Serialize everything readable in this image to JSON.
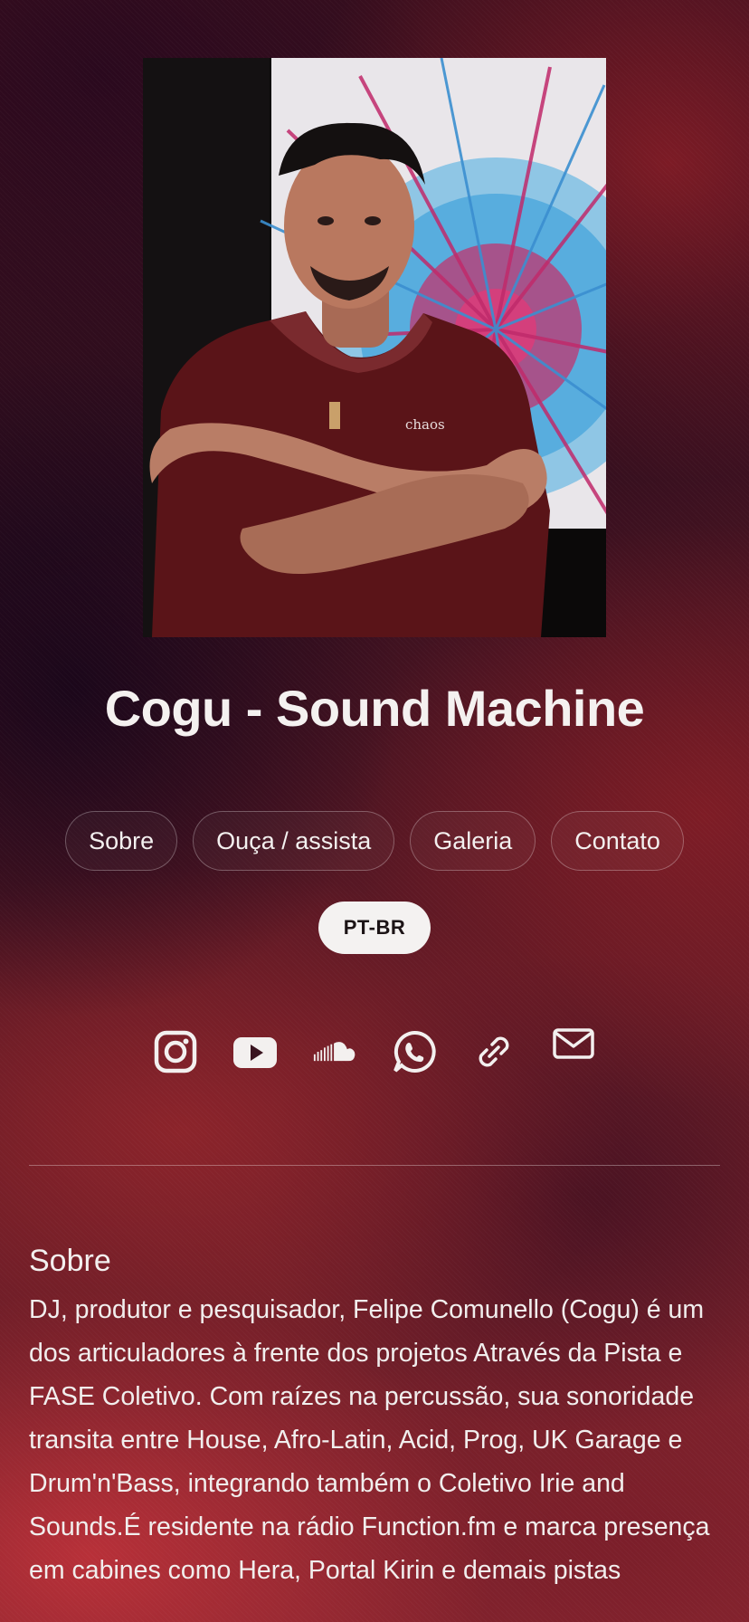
{
  "header": {
    "title": "Cogu - Sound Machine"
  },
  "nav": {
    "items": [
      {
        "label": "Sobre"
      },
      {
        "label": "Ouça / assista"
      },
      {
        "label": "Galeria"
      },
      {
        "label": "Contato"
      }
    ],
    "language": "PT-BR"
  },
  "social": {
    "icons": [
      "instagram-icon",
      "youtube-icon",
      "soundcloud-icon",
      "whatsapp-icon",
      "link-icon",
      "email-icon"
    ]
  },
  "about": {
    "title": "Sobre",
    "text": "DJ, produtor e pesquisador, Felipe Comunello (Cogu) é um dos articuladores à frente dos projetos Através da Pista e FASE Coletivo. Com raízes na percussão, sua sonoridade transita entre House, Afro-Latin, Acid, Prog, UK Garage e Drum'n'Bass, integrando também o Coletivo Irie and Sounds.É residente na rádio Function.fm e marca presença em cabines como Hera, Portal Kirin e demais pistas"
  },
  "colors": {
    "background": "#2a0f18",
    "accent_red": "#8a2630",
    "text": "#f3f0ef",
    "language_pill": "#f4f2f1"
  }
}
